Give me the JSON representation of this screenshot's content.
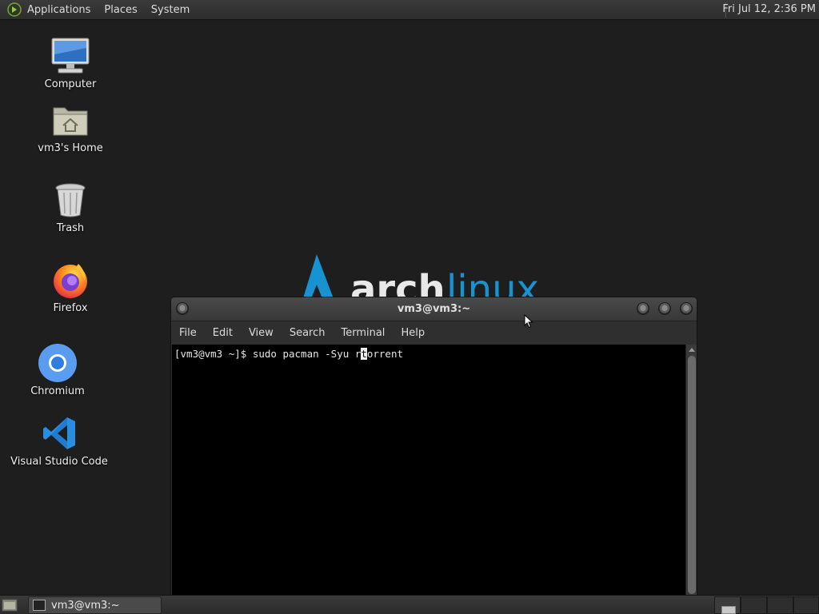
{
  "top_panel": {
    "menus": [
      "Applications",
      "Places",
      "System"
    ],
    "clock": "Fri Jul 12,  2:36 PM"
  },
  "desktop": {
    "icons": [
      {
        "label": "Computer",
        "icon": "computer-icon"
      },
      {
        "label": "vm3's Home",
        "icon": "home-folder-icon"
      },
      {
        "label": "Trash",
        "icon": "trash-icon"
      },
      {
        "label": "Firefox",
        "icon": "firefox-icon"
      },
      {
        "label": "Chromium",
        "icon": "chromium-icon"
      },
      {
        "label": "Visual Studio Code",
        "icon": "vscode-icon"
      }
    ],
    "wallpaper": "arch linux"
  },
  "terminal": {
    "title": "vm3@vm3:~",
    "menus": [
      "File",
      "Edit",
      "View",
      "Search",
      "Terminal",
      "Help"
    ],
    "prompt": "[vm3@vm3 ~]$ ",
    "command_before_cursor": "sudo pacman -Syu r",
    "cursor_char": "t",
    "command_after_cursor": "orrent"
  },
  "taskbar": {
    "task_label": "vm3@vm3:~",
    "workspaces": 4
  },
  "colors": {
    "desktop_bg": "#1e1e1e",
    "arch_blue": "#1793d1",
    "terminal_bg": "#000000"
  }
}
